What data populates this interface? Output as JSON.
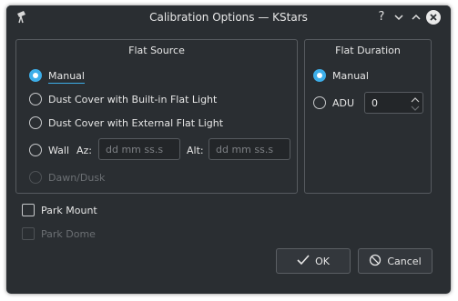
{
  "window": {
    "title": "Calibration Options — KStars"
  },
  "titlebar_buttons": {
    "help": "?",
    "minimize": "⌄",
    "maximize": "⌃",
    "close": "✕"
  },
  "flat_source": {
    "title": "Flat Source",
    "options": [
      {
        "label": "Manual",
        "checked": true,
        "enabled": true
      },
      {
        "label": "Dust Cover with Built-in Flat Light",
        "checked": false,
        "enabled": true
      },
      {
        "label": "Dust Cover with External Flat Light",
        "checked": false,
        "enabled": true
      },
      {
        "label": "Wall",
        "checked": false,
        "enabled": true
      },
      {
        "label": "Dawn/Dusk",
        "checked": false,
        "enabled": false
      }
    ],
    "az_label": "Az:",
    "az_placeholder": "dd mm ss.s",
    "alt_label": "Alt:",
    "alt_placeholder": "dd mm ss.s"
  },
  "flat_duration": {
    "title": "Flat Duration",
    "manual_label": "Manual",
    "adu_label": "ADU",
    "adu_value": "0"
  },
  "options": {
    "park_mount": "Park Mount",
    "park_dome": "Park Dome"
  },
  "buttons": {
    "ok": "OK",
    "cancel": "Cancel"
  },
  "colors": {
    "accent": "#3daee9",
    "background": "#2a2e32"
  }
}
